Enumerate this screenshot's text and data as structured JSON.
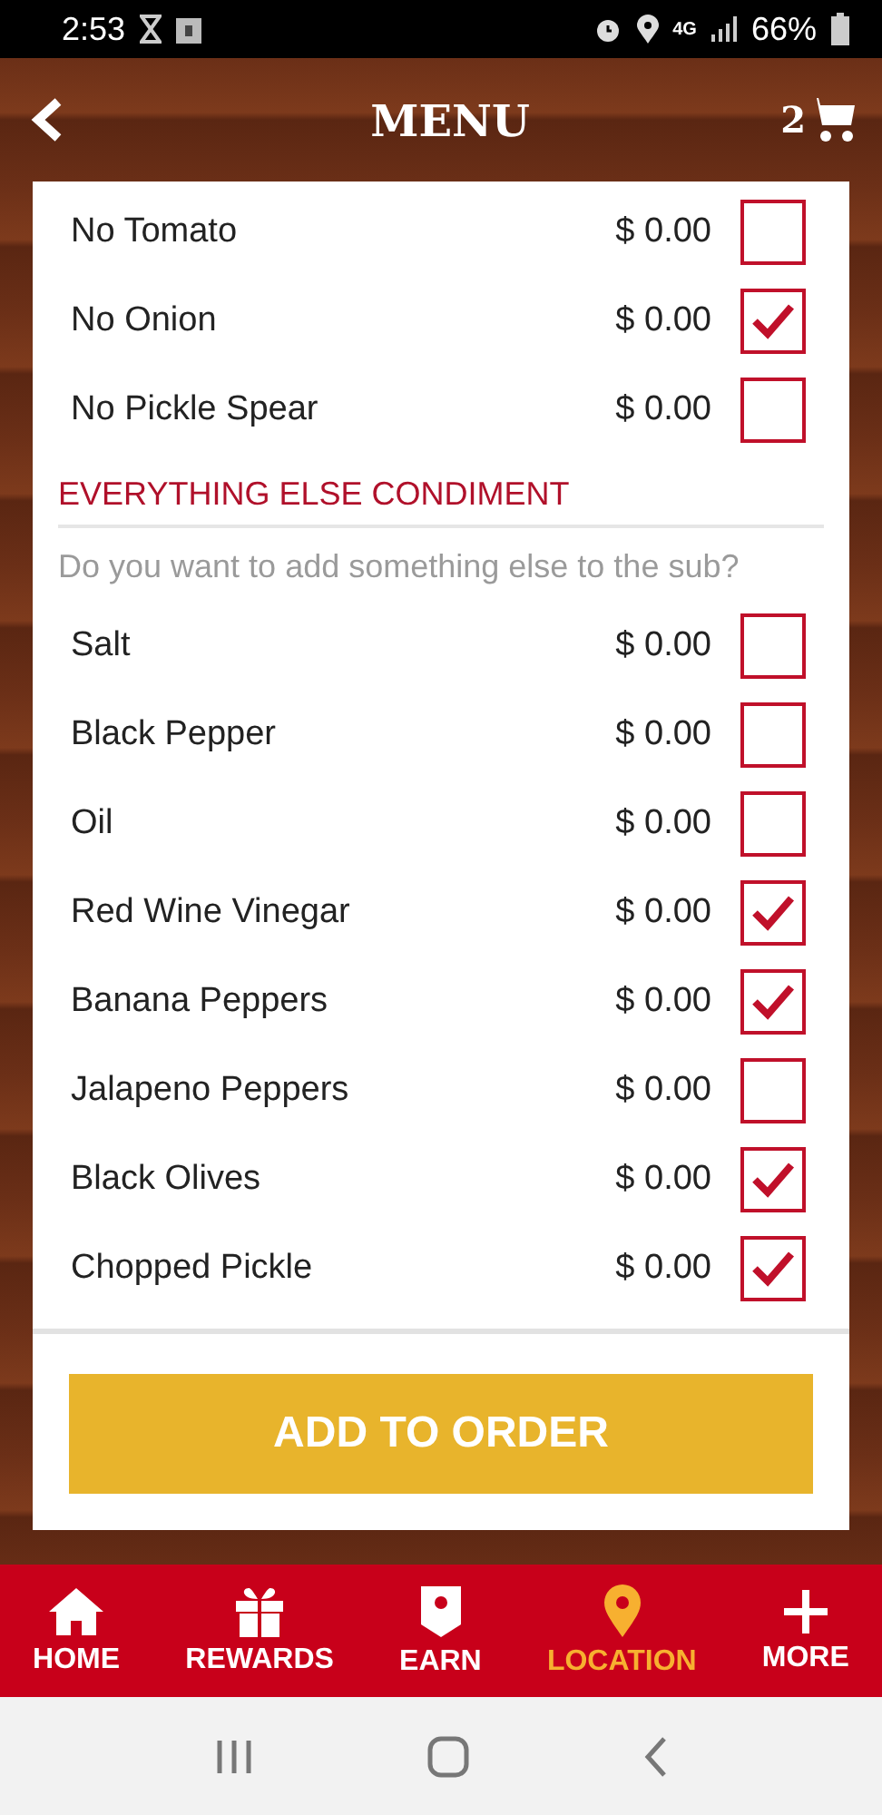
{
  "status_bar": {
    "time": "2:53",
    "network": "4G",
    "battery": "66%"
  },
  "header": {
    "title": "MENU",
    "cart_count": "2"
  },
  "top_options": [
    {
      "name": "No Tomato",
      "price": "$ 0.00",
      "checked": false
    },
    {
      "name": "No Onion",
      "price": "$ 0.00",
      "checked": true
    },
    {
      "name": "No Pickle Spear",
      "price": "$ 0.00",
      "checked": false
    }
  ],
  "section": {
    "title": "EVERYTHING ELSE CONDIMENT",
    "subtitle": "Do you want to add something else to the sub?",
    "options": [
      {
        "name": "Salt",
        "price": "$ 0.00",
        "checked": false
      },
      {
        "name": "Black Pepper",
        "price": "$ 0.00",
        "checked": false
      },
      {
        "name": "Oil",
        "price": "$ 0.00",
        "checked": false
      },
      {
        "name": "Red Wine Vinegar",
        "price": "$ 0.00",
        "checked": true
      },
      {
        "name": "Banana Peppers",
        "price": "$ 0.00",
        "checked": true
      },
      {
        "name": "Jalapeno Peppers",
        "price": "$ 0.00",
        "checked": false
      },
      {
        "name": "Black Olives",
        "price": "$ 0.00",
        "checked": true
      },
      {
        "name": "Chopped Pickle",
        "price": "$ 0.00",
        "checked": true
      }
    ]
  },
  "add_button": "ADD TO ORDER",
  "nav": [
    {
      "kind": "home",
      "label": "HOME",
      "selected": false
    },
    {
      "kind": "gift",
      "label": "REWARDS",
      "selected": false
    },
    {
      "kind": "badge",
      "label": "EARN",
      "selected": false
    },
    {
      "kind": "pin",
      "label": "LOCATION",
      "selected": true
    },
    {
      "kind": "plus",
      "label": "MORE",
      "selected": false
    }
  ]
}
